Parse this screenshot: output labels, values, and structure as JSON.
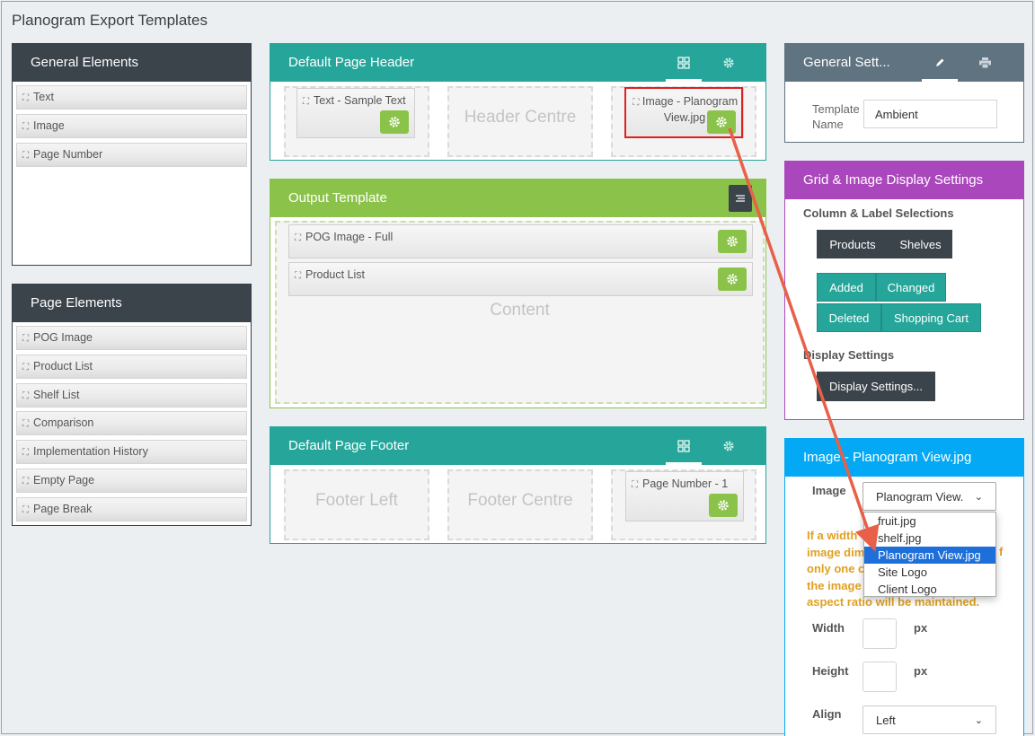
{
  "page": {
    "title": "Planogram Export Templates"
  },
  "general_elements": {
    "title": "General Elements",
    "items": [
      "Text",
      "Image",
      "Page Number"
    ]
  },
  "page_elements": {
    "title": "Page Elements",
    "items": [
      "POG Image",
      "Product List",
      "Shelf List",
      "Comparison",
      "Implementation History",
      "Empty Page",
      "Page Break"
    ]
  },
  "header": {
    "title": "Default Page Header",
    "left_card": "Text - Sample Text",
    "centre": "Header Centre",
    "right_card": "Image - Planogram View.jpg"
  },
  "output": {
    "title": "Output Template",
    "rows": [
      "POG Image - Full",
      "Product List"
    ],
    "content_label": "Content"
  },
  "footer": {
    "title": "Default Page Footer",
    "left": "Footer Left",
    "centre": "Footer Centre",
    "right_card": "Page Number - 1"
  },
  "general_settings": {
    "title": "General Sett...",
    "template_label": "Template Name",
    "template_value": "Ambient"
  },
  "grid_settings": {
    "title": "Grid & Image Display Settings",
    "column_label": "Column & Label Selections",
    "btn_products": "Products",
    "btn_shelves": "Shelves",
    "btn_added": "Added",
    "btn_changed": "Changed",
    "btn_deleted": "Deleted",
    "btn_cart": "Shopping Cart",
    "display_label": "Display Settings",
    "display_btn": "Display Settings..."
  },
  "image_panel": {
    "title": "Image - Planogram View.jpg",
    "image_label": "Image",
    "selected": "Planogram View.",
    "options": [
      "fruit.jpg",
      "shelf.jpg",
      "Planogram View.jpg",
      "Site Logo",
      "Client Logo"
    ],
    "warning_lines": [
      "If a width",
      "image dim",
      "only one c",
      "the image",
      "aspect ratio will be maintained."
    ],
    "warning_tail": "f",
    "width_label": "Width",
    "height_label": "Height",
    "px": "px",
    "align_label": "Align",
    "align_value": "Left"
  },
  "colors": {
    "dark": "#3b434b",
    "teal": "#26a69a",
    "green": "#8bc34a",
    "slate": "#5f7380",
    "purple": "#ab47bc",
    "blue": "#03a9f4",
    "warning": "#e0a020",
    "highlight": "#e02020",
    "arrow": "#e8604a"
  }
}
